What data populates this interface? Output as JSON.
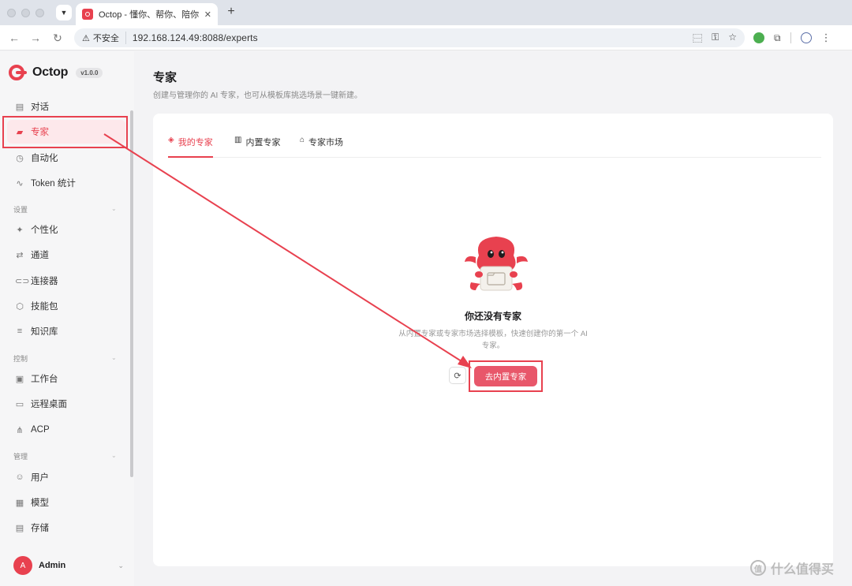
{
  "browser": {
    "tab_title": "Octop - 懂你、帮你、陪你成长",
    "security_label": "不安全",
    "url": "192.168.124.49:8088/experts",
    "new_tab": "+",
    "tab_close": "✕"
  },
  "app": {
    "name": "Octop",
    "version": "v1.0.0",
    "accent_color": "#e8414f"
  },
  "sidebar": {
    "items_main": [
      {
        "label": "对话",
        "icon": "chat-icon",
        "glyph": "▤"
      },
      {
        "label": "专家",
        "icon": "graduation-cap-icon",
        "glyph": "▰",
        "active": true
      },
      {
        "label": "自动化",
        "icon": "timer-icon",
        "glyph": "◷"
      },
      {
        "label": "Token 统计",
        "icon": "activity-icon",
        "glyph": "∿"
      }
    ],
    "section_settings": "设置",
    "items_settings": [
      {
        "label": "个性化",
        "icon": "sparkles-icon",
        "glyph": "✦"
      },
      {
        "label": "通道",
        "icon": "channel-icon",
        "glyph": "⇄"
      },
      {
        "label": "连接器",
        "icon": "link-icon",
        "glyph": "⊂⊃"
      },
      {
        "label": "技能包",
        "icon": "package-icon",
        "glyph": "⬡"
      },
      {
        "label": "知识库",
        "icon": "database-icon",
        "glyph": "≡"
      }
    ],
    "section_control": "控制",
    "items_control": [
      {
        "label": "工作台",
        "icon": "workspace-icon",
        "glyph": "▣"
      },
      {
        "label": "远程桌面",
        "icon": "monitor-icon",
        "glyph": "▭"
      },
      {
        "label": "ACP",
        "icon": "share-icon",
        "glyph": "⋔"
      }
    ],
    "section_manage": "管理",
    "items_manage": [
      {
        "label": "用户",
        "icon": "users-icon",
        "glyph": "☺"
      },
      {
        "label": "模型",
        "icon": "cpu-icon",
        "glyph": "▦"
      },
      {
        "label": "存储",
        "icon": "storage-icon",
        "glyph": "▤"
      }
    ],
    "user": {
      "avatar_letter": "A",
      "name": "Admin"
    }
  },
  "main": {
    "title": "专家",
    "description": "创建与管理你的 AI 专家，也可从模板库挑选场景一键新建。",
    "tabs": [
      {
        "label": "我的专家",
        "icon": "graduation-cap-icon",
        "glyph": "◈",
        "active": true
      },
      {
        "label": "内置专家",
        "icon": "book-icon",
        "glyph": "▥"
      },
      {
        "label": "专家市场",
        "icon": "store-icon",
        "glyph": "⌂"
      }
    ],
    "empty_state": {
      "title": "你还没有专家",
      "description": "从内置专家或专家市场选择模板，快速创建你的第一个 AI 专家。",
      "refresh_icon": "refresh-icon",
      "cta_label": "去内置专家"
    }
  },
  "watermark": {
    "text": "什么值得买",
    "icon_glyph": "值"
  }
}
